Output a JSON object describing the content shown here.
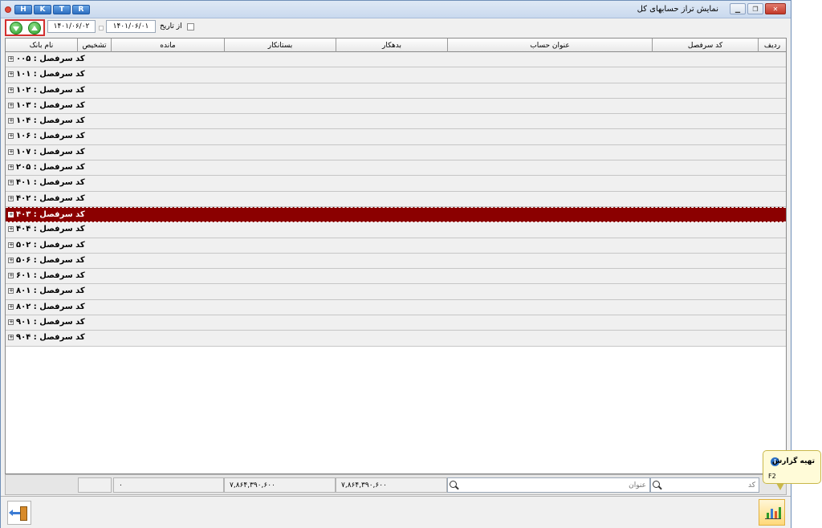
{
  "window": {
    "title": "نمایش تراز حسابهای کل",
    "hotkeys": [
      "H",
      "K",
      "T",
      "R"
    ]
  },
  "toolbar": {
    "from_date_label": "از تاریخ",
    "from_date": "۱۴۰۱/۰۶/۰۱",
    "to_date": "۱۴۰۱/۰۶/۰۲"
  },
  "grid": {
    "columns": [
      "ردیف",
      "کد سرفصل",
      "عنوان حساب",
      "بدهکار",
      "بستانکار",
      "مانده",
      "تشخیص",
      "نام بانک"
    ],
    "rows": [
      "کد سرفصل : ۰۰۵",
      "کد سرفصل : ۱۰۱",
      "کد سرفصل : ۱۰۲",
      "کد سرفصل : ۱۰۳",
      "کد سرفصل : ۱۰۴",
      "کد سرفصل : ۱۰۶",
      "کد سرفصل : ۱۰۷",
      "کد سرفصل : ۲۰۵",
      "کد سرفصل : ۴۰۱",
      "کد سرفصل : ۴۰۲",
      "کد سرفصل : ۴۰۳",
      "کد سرفصل : ۴۰۴",
      "کد سرفصل : ۵۰۲",
      "کد سرفصل : ۵۰۶",
      "کد سرفصل : ۶۰۱",
      "کد سرفصل : ۸۰۱",
      "کد سرفصل : ۸۰۲",
      "کد سرفصل : ۹۰۱",
      "کد سرفصل : ۹۰۴"
    ],
    "selected_row": "کد سرفصل : ۴۰۳"
  },
  "footer": {
    "code_placeholder": "کد",
    "title_placeholder": "عنوان",
    "debit_total": "۷,۸۶۴,۳۹۰,۶۰۰",
    "credit_total": "۷,۸۶۴,۳۹۰,۶۰۰",
    "balance_total": "۰"
  },
  "tooltip": {
    "title": "تهیه گزارش",
    "shortcut": "F2"
  },
  "colors": {
    "selected_row": "#8b0000",
    "nav_highlight": "#d32f2f",
    "green_button": "#2e9b2a"
  }
}
